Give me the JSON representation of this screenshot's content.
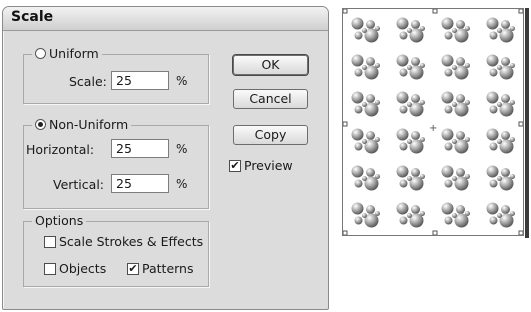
{
  "dialog": {
    "title": "Scale",
    "uniform": {
      "label": "Uniform",
      "selected": false,
      "scale_label": "Scale:",
      "scale_value": "25",
      "unit": "%"
    },
    "non_uniform": {
      "label": "Non-Uniform",
      "selected": true,
      "horizontal_label": "Horizontal:",
      "horizontal_value": "25",
      "vertical_label": "Vertical:",
      "vertical_value": "25",
      "unit_h": "%",
      "unit_v": "%"
    },
    "options": {
      "label": "Options",
      "scale_strokes": {
        "label": "Scale Strokes & Effects",
        "checked": false
      },
      "objects": {
        "label": "Objects",
        "checked": false
      },
      "patterns": {
        "label": "Patterns",
        "checked": true
      }
    },
    "buttons": {
      "ok": "OK",
      "cancel": "Cancel",
      "copy": "Copy"
    },
    "preview": {
      "label": "Preview",
      "checked": true
    }
  },
  "canvas": {
    "pattern": "gray-sphere-clusters",
    "rows": 6,
    "cols": 4
  }
}
